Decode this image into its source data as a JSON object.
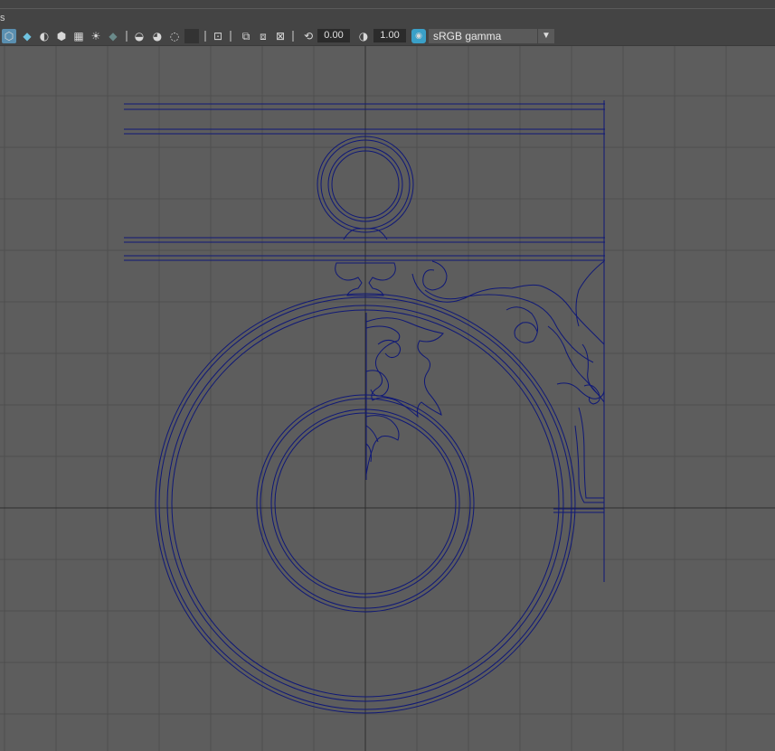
{
  "menu_fragment": "s",
  "toolbar": {
    "exposure_value": "0.00",
    "gamma_value": "1.00",
    "color_space": "sRGB gamma"
  },
  "colors": {
    "background": "#5d5d5d",
    "grid": "#4e4e4e",
    "axis": "#2e2e2e",
    "wireframe": "#0f1877",
    "toolbar": "#444444",
    "accent": "#5a8fb0"
  }
}
